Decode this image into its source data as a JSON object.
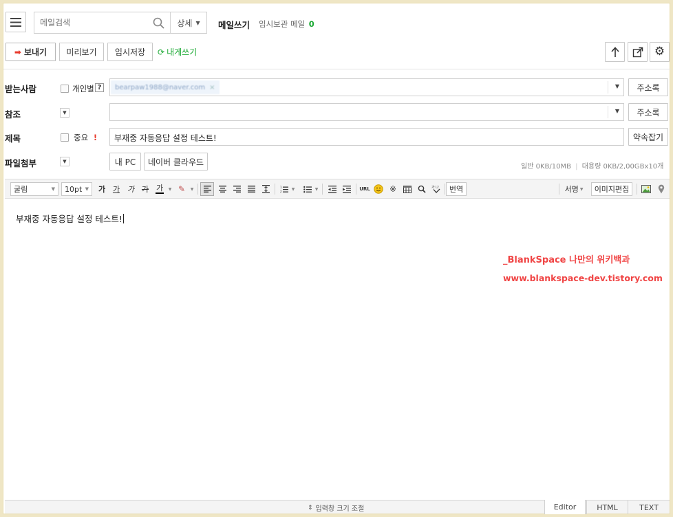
{
  "header": {
    "search_placeholder": "메일검색",
    "detail_label": "상세",
    "title": "메일쓰기",
    "temp_saved_label": "임시보관 메일",
    "temp_saved_count": "0"
  },
  "actions": {
    "send": "보내기",
    "preview": "미리보기",
    "save_temp": "임시저장",
    "self_write": "내게쓰기"
  },
  "form": {
    "to_label": "받는사람",
    "individual_label": "개인별",
    "help": "?",
    "to_chip": "bearpaw1988@naver.com",
    "address_book": "주소록",
    "cc_label": "참조",
    "subject_label": "제목",
    "important_label": "중요",
    "important_mark": "!",
    "subject_value": "부재중 자동응답 설정 테스트!",
    "keyword_button": "약속잡기",
    "attach_label": "파일첨부",
    "my_pc": "내 PC",
    "naver_cloud": "네이버 클라우드",
    "quota_general": "일반 0KB/10MB",
    "quota_large": "대용량 0KB/2,00GBx10개"
  },
  "toolbar": {
    "font": "굴림",
    "size": "10pt",
    "bold": "가",
    "underline": "가",
    "italic": "가",
    "strike": "가",
    "fontcolor": "가",
    "url": "URL",
    "translate": "번역",
    "signature": "서명",
    "image_edit": "이미지편집"
  },
  "editor": {
    "body": "부재중 자동응답 설정 테스트!",
    "watermark_line1": "_BlankSpace 나만의 위키백과",
    "watermark_line2": "www.blankspace-dev.tistory.com"
  },
  "footer": {
    "resize": "입력창 크기 조절",
    "tabs": [
      "Editor",
      "HTML",
      "TEXT"
    ]
  },
  "colors": {
    "accent_green": "#19a832",
    "send_arrow": "#e8392b",
    "watermark": "#f04545"
  }
}
